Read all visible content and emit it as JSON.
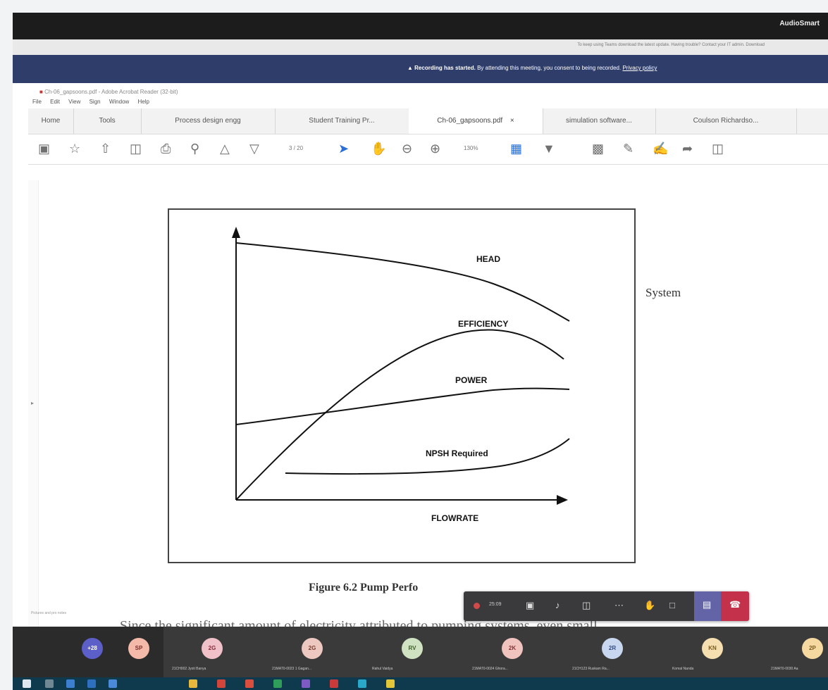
{
  "topbar": {
    "brand": "AudioSmart"
  },
  "notice": {
    "text": "To keep using Teams download the latest update. Having trouble? Contact your IT admin. Download"
  },
  "recording": {
    "lead": "Recording has started.",
    "text": " By attending this meeting, you consent to being recorded.",
    "link": "Privacy policy"
  },
  "acrobat": {
    "window_title": "Ch-06_gapsoons.pdf - Adobe Acrobat Reader (32-bit)",
    "menu": [
      "File",
      "Edit",
      "View",
      "Sign",
      "Window",
      "Help"
    ],
    "tabs": [
      {
        "label": "Home"
      },
      {
        "label": "Tools"
      },
      {
        "label": "Process design engg"
      },
      {
        "label": "Student Training Pr..."
      },
      {
        "label": "Ch-06_gapsoons.pdf"
      },
      {
        "label": "simulation software..."
      },
      {
        "label": "Coulson Richardso..."
      }
    ],
    "tab_close": "×",
    "page_indicator": "3 / 20",
    "zoom": "130%"
  },
  "figure": {
    "curve_labels": {
      "head": "HEAD",
      "efficiency": "EFFICIENCY",
      "power": "POWER",
      "npsh": "NPSH Required"
    },
    "x_axis_label": "FLOWRATE",
    "side_text": "System",
    "caption": "Figure 6.2  Pump Perfo",
    "next_line": "Since the significant amount of electricity attributed to pumping systems, even small"
  },
  "credit": "Pictures and pro notes",
  "meeting": {
    "timer": "25:09"
  },
  "participants": [
    {
      "initials": "+28",
      "name": "",
      "bg": "#5b5fc7",
      "fg": "#ffffff"
    },
    {
      "initials": "SP",
      "name": "",
      "bg": "#f4b9a8",
      "fg": "#7a2e2e"
    },
    {
      "initials": "2G",
      "name": "21CH002 Jyoti Banya",
      "bg": "#f1c1c9",
      "fg": "#8a2a3a"
    },
    {
      "initials": "2G",
      "name": "21MAT0-0023 1 Gagan...",
      "bg": "#ecc8c0",
      "fg": "#7a3d2e"
    },
    {
      "initials": "RV",
      "name": "Rahul Vaidya",
      "bg": "#cfe3c2",
      "fg": "#3f5e2a"
    },
    {
      "initials": "2K",
      "name": "21MAT0-0024 Ghora...",
      "bg": "#f1c3bf",
      "fg": "#8a2e2e"
    },
    {
      "initials": "2R",
      "name": "21CH123 Ruskam Ra...",
      "bg": "#c9d6ef",
      "fg": "#2e4a8a"
    },
    {
      "initials": "KN",
      "name": "Komal Nanda",
      "bg": "#f5dfb0",
      "fg": "#7a5a1e"
    },
    {
      "initials": "2P",
      "name": "21MAT0-0030 Aa",
      "bg": "#f5d9a0",
      "fg": "#7a5a1e"
    }
  ],
  "colors": {
    "rec_banner": "#2f3d6b",
    "hangup": "#c4314b",
    "share": "#6264a7"
  }
}
